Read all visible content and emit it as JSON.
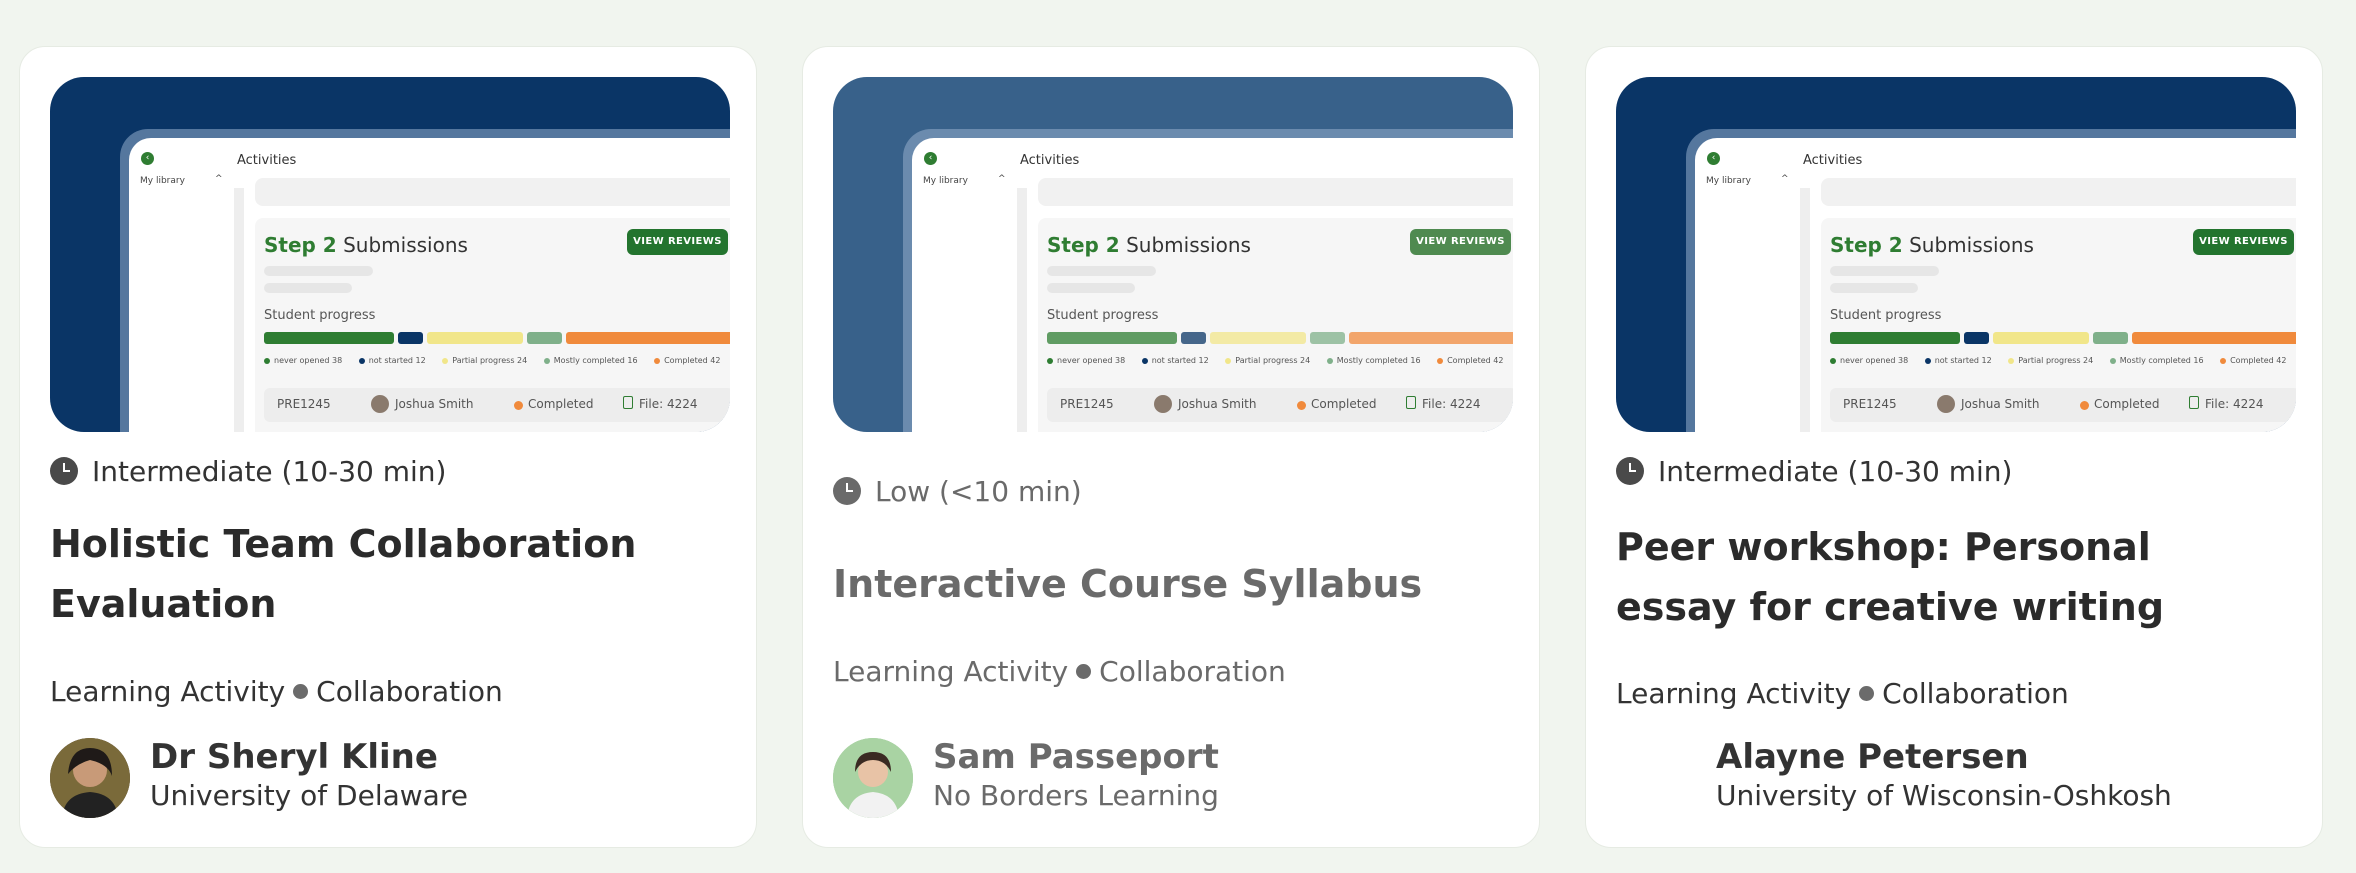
{
  "thumbnail": {
    "header_title": "Activities",
    "sidebar_label": "My library",
    "step_label": "Step 2",
    "step_title": "Submissions",
    "view_reviews_label": "VIEW REVIEWS",
    "progress_label": "Student progress",
    "legend": [
      {
        "label": "never opened 38",
        "color": "#2e7d32"
      },
      {
        "label": "not started 12",
        "color": "#0a3566"
      },
      {
        "label": "Partial progress 24",
        "color": "#f1e68a"
      },
      {
        "label": "Mostly completed 16",
        "color": "#7fb08a"
      },
      {
        "label": "Completed 42",
        "color": "#f08a3c"
      }
    ],
    "row": {
      "id": "PRE1245",
      "name": "Joshua Smith",
      "status": "Completed",
      "file": "File:  4224"
    }
  },
  "cards": [
    {
      "difficulty": "Intermediate (10-30 min)",
      "title": "Holistic Team Collaboration Evaluation",
      "type": "Learning Activity",
      "category": "Collaboration",
      "author": "Dr Sheryl Kline",
      "organization": "University of Delaware"
    },
    {
      "difficulty": "Low (<10 min)",
      "title": "Interactive Course Syllabus",
      "type": "Learning Activity",
      "category": "Collaboration",
      "author": "Sam Passeport",
      "organization": "No Borders Learning"
    },
    {
      "difficulty": "Intermediate (10-30 min)",
      "title": "Peer workshop: Personal essay for creative writing",
      "type": "Learning Activity",
      "category": "Collaboration",
      "author": "Alayne Petersen",
      "organization": "University of Wisconsin-Oshkosh"
    }
  ]
}
